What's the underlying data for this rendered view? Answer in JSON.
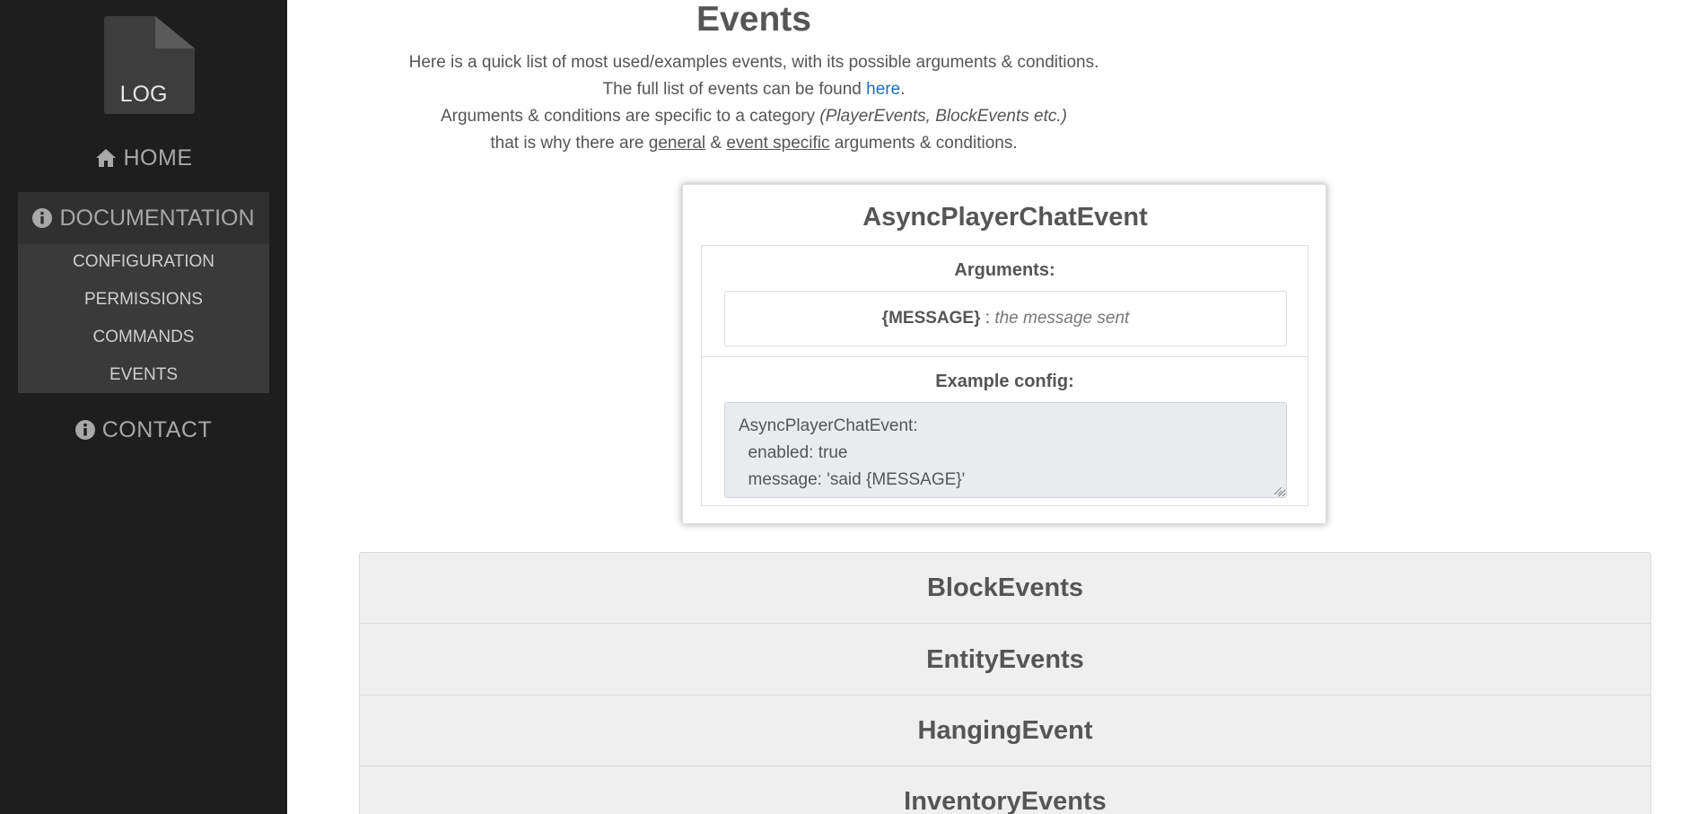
{
  "logo": {
    "text": "LOG",
    "icon": "log-file-icon"
  },
  "sidebar": {
    "home": {
      "label": "HOME",
      "icon": "home-icon"
    },
    "documentation": {
      "label": "DOCUMENTATION",
      "icon": "info-icon",
      "items": [
        "CONFIGURATION",
        "PERMISSIONS",
        "COMMANDS",
        "EVENTS"
      ]
    },
    "contact": {
      "label": "CONTACT",
      "icon": "info-icon"
    }
  },
  "main": {
    "title": "Events",
    "intro": {
      "line1": "Here is a quick list of most used/examples events, with its possible arguments & conditions.",
      "line2_before": "The full list of events can be found ",
      "line2_link": "here",
      "line2_after": ".",
      "line3_before": "Arguments & conditions are specific to a category ",
      "line3_italic": "(PlayerEvents, BlockEvents etc.)",
      "line4_before": "that is why there are ",
      "line4_general": "general",
      "line4_amp": " & ",
      "line4_specific": "event specific",
      "line4_after": " arguments & conditions."
    },
    "event_card": {
      "title": "AsyncPlayerChatEvent",
      "arguments_label": "Arguments:",
      "argument_name": "{MESSAGE}",
      "argument_sep": " : ",
      "argument_desc": "the message sent",
      "example_label": "Example config:",
      "example_config": "AsyncPlayerChatEvent:\n  enabled: true\n  message: 'said {MESSAGE}'"
    },
    "accordion": [
      "BlockEvents",
      "EntityEvents",
      "HangingEvent",
      "InventoryEvents"
    ]
  },
  "colors": {
    "sidebar_bg": "#1e1e1e",
    "doc_block_bg": "#3a3a3a",
    "link": "#1a6fc2",
    "text": "#555555",
    "accordion_bg": "#efefef",
    "code_bg": "#e9ecef"
  }
}
